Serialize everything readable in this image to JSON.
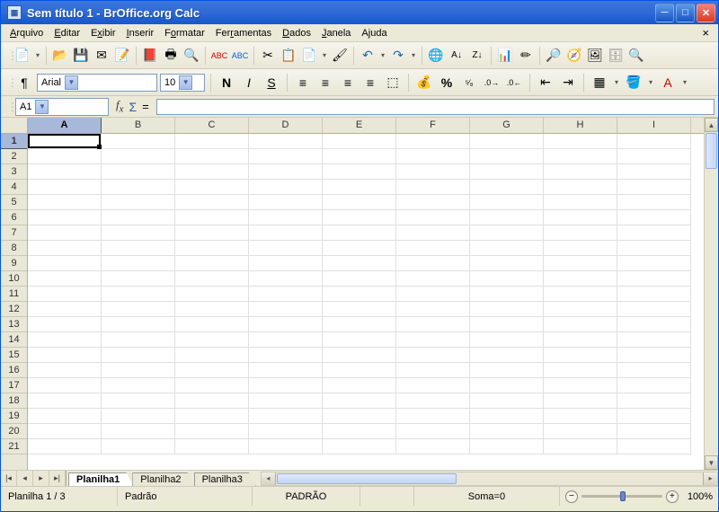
{
  "title": "Sem título 1 - BrOffice.org Calc",
  "menus": [
    "Arquivo",
    "Editar",
    "Exibir",
    "Inserir",
    "Formatar",
    "Ferramentas",
    "Dados",
    "Janela",
    "Ajuda"
  ],
  "menu_accel": [
    0,
    0,
    1,
    0,
    1,
    3,
    0,
    0,
    1
  ],
  "font_name": "Arial",
  "font_size": "10",
  "cell_ref": "A1",
  "equals": "=",
  "columns": [
    "A",
    "B",
    "C",
    "D",
    "E",
    "F",
    "G",
    "H",
    "I"
  ],
  "rows": [
    "1",
    "2",
    "3",
    "4",
    "5",
    "6",
    "7",
    "8",
    "9",
    "10",
    "11",
    "12",
    "13",
    "14",
    "15",
    "16",
    "17",
    "18",
    "19",
    "20",
    "21"
  ],
  "selected_col": 0,
  "selected_row": 0,
  "sheets": [
    "Planilha1",
    "Planilha2",
    "Planilha3"
  ],
  "active_sheet": 0,
  "status": {
    "sheet_pos": "Planilha 1 / 3",
    "style": "Padrão",
    "mode": "PADRÃO",
    "sum": "Soma=0",
    "zoom": "100%"
  },
  "fmt_btns": {
    "bold": "N",
    "italic": "I",
    "underline": "S"
  }
}
